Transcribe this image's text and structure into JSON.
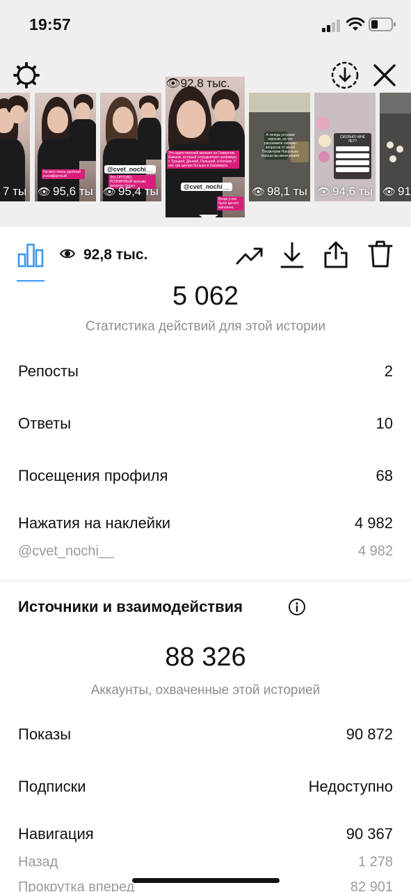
{
  "status_bar": {
    "time": "19:57"
  },
  "thumbnails": [
    {
      "views": "7 ты"
    },
    {
      "views": "95,6 ты"
    },
    {
      "views": "95,4 ты"
    },
    {
      "views": "92,8 тыс."
    },
    {
      "views": "98,1 ты"
    },
    {
      "views": "94,6 ты"
    },
    {
      "views": "91"
    }
  ],
  "thumb_text": {
    "sticker": "@cvet_nochi__",
    "active_caption": "Это единственный магазин на Северном Кавказе, который сотрудничает напрямую с Турцией, Данией, Польшей, и Китаем. У них три центра больше в Хасавюрте.",
    "active_bottom": "Вещи у них было целого магазина",
    "thumb3_caption": "Это ОПТОВО- РОЗНИЧНЫЙ магазин женского белья",
    "thumb2_caption": "На него очень удобный и комфортный",
    "thumb5_text": "А теперь устроим опросик, на что расскажите сколько вопросов от меня! Посмотрим Насколько хорошо вы меня знаете",
    "thumb6_title": "СКОЛЬКО МНЕ ЛЕТ?"
  },
  "action_bar": {
    "view_count": "92,8 тыс."
  },
  "interactions": {
    "total": "5 062",
    "subtitle": "Статистика действий для этой истории",
    "rows": [
      {
        "label": "Репосты",
        "value": "2"
      },
      {
        "label": "Ответы",
        "value": "10"
      },
      {
        "label": "Посещения профиля",
        "value": "68"
      },
      {
        "label": "Нажатия на наклейки",
        "value": "4 982"
      }
    ],
    "sticker_row": {
      "label": "@cvet_nochi__",
      "value": "4 982"
    }
  },
  "discovery": {
    "title": "Источники и взаимодействия",
    "total": "88 326",
    "subtitle": "Аккаунты, охваченные этой историей",
    "rows": [
      {
        "label": "Показы",
        "value": "90 872"
      },
      {
        "label": "Подписки",
        "value": "Недоступно"
      },
      {
        "label": "Навигация",
        "value": "90 367"
      }
    ],
    "nav_rows": [
      {
        "label": "Назад",
        "value": "1 278"
      },
      {
        "label": "Прокрутка вперед",
        "value": "82 901"
      }
    ]
  },
  "colors": {
    "accent": "#3897f0",
    "top_bg": "#efefef",
    "muted": "#8e8e8e",
    "sticker_pink": "#d91f7b"
  },
  "icons": [
    "gear-icon",
    "download-circle-icon",
    "close-icon",
    "bar-chart-icon",
    "eye-icon",
    "trend-icon",
    "download-icon",
    "share-icon",
    "trash-icon",
    "info-icon"
  ]
}
